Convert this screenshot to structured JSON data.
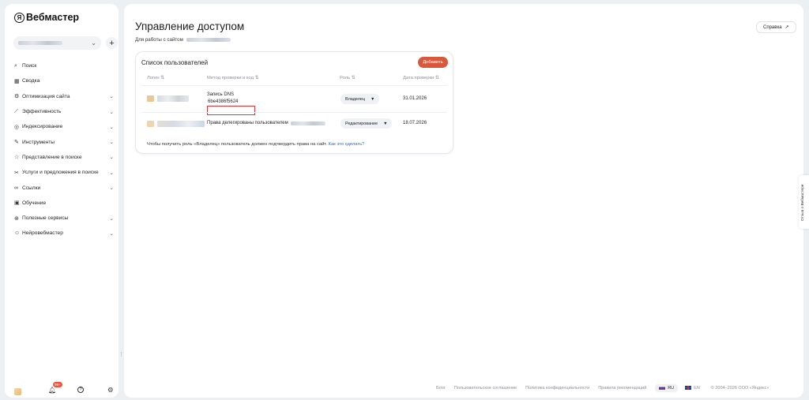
{
  "app": {
    "logo_mark": "Я",
    "logo_text": "Вебмастер"
  },
  "sidebar": {
    "add_site_label": "+",
    "items": [
      {
        "label": "Поиск",
        "icon": "search-icon",
        "glyph": "⌕",
        "chevron": false
      },
      {
        "label": "Сводка",
        "icon": "grid-icon",
        "glyph": "▦",
        "chevron": false
      },
      {
        "label": "Оптимизация сайта",
        "icon": "wrench-icon",
        "glyph": "⚙",
        "chevron": true
      },
      {
        "label": "Эффективность",
        "icon": "chart-icon",
        "glyph": "⟋",
        "chevron": true
      },
      {
        "label": "Индексирование",
        "icon": "index-icon",
        "glyph": "◎",
        "chevron": true
      },
      {
        "label": "Инструменты",
        "icon": "tools-icon",
        "glyph": "✎",
        "chevron": true
      },
      {
        "label": "Представление в поиске",
        "icon": "presentation-icon",
        "glyph": "☆",
        "chevron": true
      },
      {
        "label": "Услуги и предложения в поиске",
        "icon": "services-icon",
        "glyph": "✂",
        "chevron": true
      },
      {
        "label": "Ссылки",
        "icon": "link-icon",
        "glyph": "∞",
        "chevron": true
      },
      {
        "label": "Обучение",
        "icon": "book-icon",
        "glyph": "▣",
        "chevron": false
      },
      {
        "label": "Полезные сервисы",
        "icon": "services-grid-icon",
        "glyph": "⊕",
        "chevron": true
      },
      {
        "label": "Нейровебмастер",
        "icon": "neuro-icon",
        "glyph": "☺",
        "chevron": true
      }
    ],
    "notifications_badge": "99+",
    "help_glyph": "?"
  },
  "main": {
    "title": "Управление доступом",
    "subtitle": "Для работы с сайтом",
    "help_button": "Справка",
    "card": {
      "title": "Список пользователей",
      "add_button": "Добавить",
      "columns": [
        "Логин",
        "Метод проверки и код",
        "Роль",
        "Дата проверки"
      ],
      "rows": [
        {
          "method": "Запись DNS",
          "code": "6be4386f5624",
          "role": "Владелец",
          "date": "31.01.2026"
        },
        {
          "method": "Права делегированы пользователем",
          "code": "",
          "role": "Редактирование",
          "date": "18.07.2026"
        }
      ],
      "note": "Чтобы получить роль «Владелец» пользователь должен подтвердить права на сайт.",
      "note_link": "Как это сделать?"
    }
  },
  "footer": {
    "links": [
      "Блог",
      "Пользовательское соглашение",
      "Политика конфиденциальности",
      "Правила рекомендаций"
    ],
    "lang_ru": "RU",
    "lang_en": "EN",
    "copyright": "© 2004–2026 ООО «Яндекс»"
  },
  "feedback": {
    "label": "Отзыв о Вебмастере"
  },
  "colors": {
    "accent": "#d9583b",
    "link": "#2f69c8",
    "highlight_box": "#d43838"
  }
}
